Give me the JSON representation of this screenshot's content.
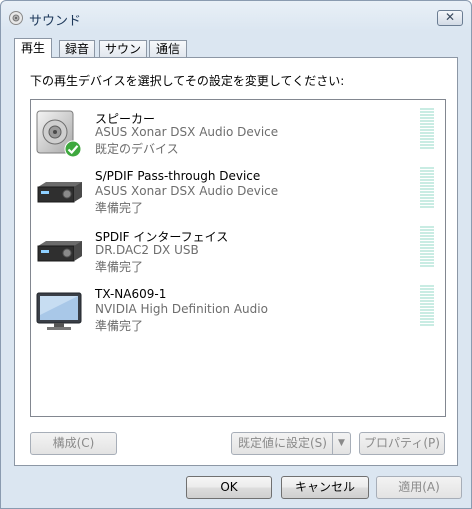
{
  "window": {
    "title": "サウンド",
    "close_label": "✕"
  },
  "tabs": [
    "再生",
    "録音",
    "サウンド",
    "通信"
  ],
  "instruction": "下の再生デバイスを選択してその設定を変更してください:",
  "devices": [
    {
      "name": "スピーカー",
      "description": "ASUS Xonar DSX Audio Device",
      "status": "既定のデバイス",
      "icon": "speaker-icon",
      "is_default": true
    },
    {
      "name": "S/PDIF Pass-through Device",
      "description": "ASUS Xonar DSX Audio Device",
      "status": "準備完了",
      "icon": "receiver-icon",
      "is_default": false
    },
    {
      "name": "SPDIF インターフェイス",
      "description": "DR.DAC2 DX USB",
      "status": "準備完了",
      "icon": "receiver-icon",
      "is_default": false
    },
    {
      "name": "TX-NA609-1",
      "description": "NVIDIA High Definition Audio",
      "status": "準備完了",
      "icon": "monitor-icon",
      "is_default": false
    }
  ],
  "panel_buttons": {
    "configure": "構成(C)",
    "set_default": "既定値に設定(S)",
    "properties": "プロパティ(P)"
  },
  "dialog_buttons": {
    "ok": "OK",
    "cancel": "キャンセル",
    "apply": "適用(A)"
  },
  "colors": {
    "default_check": "#3ea83e",
    "meter": "#c9ece3"
  }
}
